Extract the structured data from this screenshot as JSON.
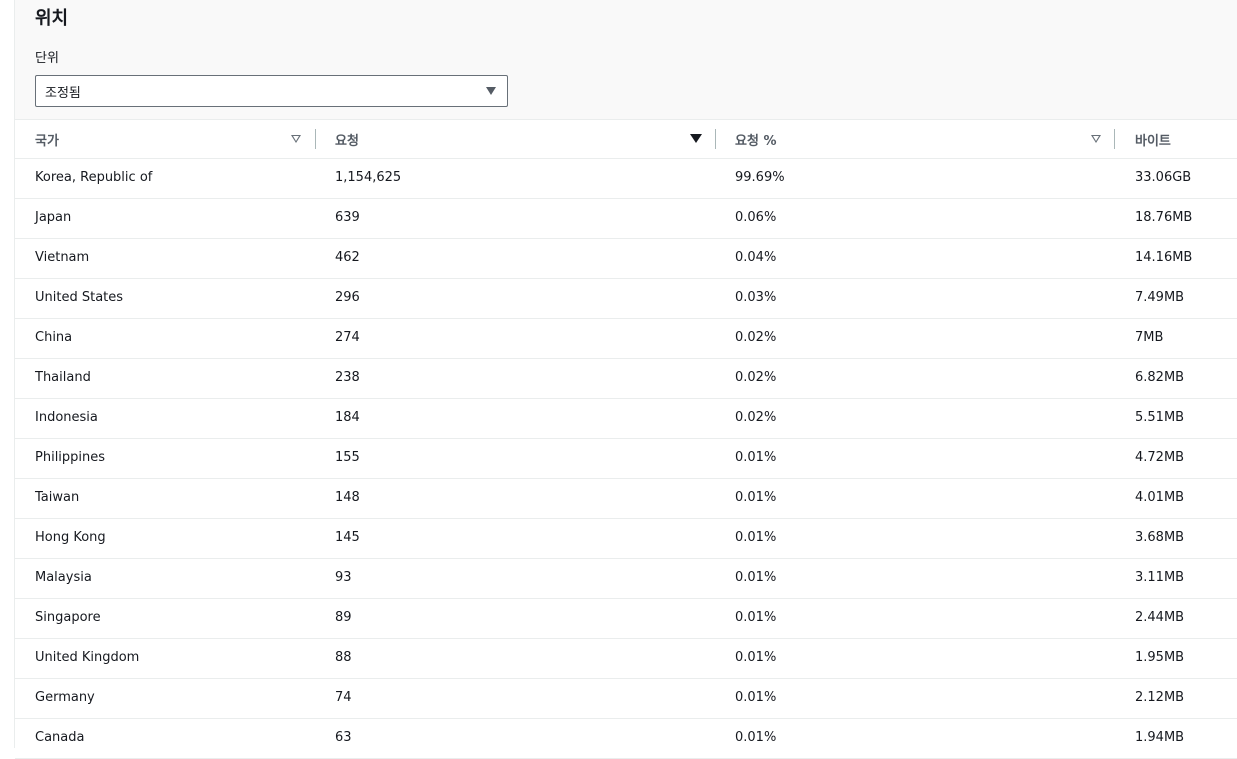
{
  "panel": {
    "title": "위치",
    "unit_label": "단위",
    "unit_select": {
      "value": "조정됨"
    }
  },
  "table": {
    "columns": [
      {
        "label": "국가",
        "sort": "none"
      },
      {
        "label": "요청",
        "sort": "descending"
      },
      {
        "label": "요청 %",
        "sort": "none"
      },
      {
        "label": "바이트",
        "sort": "none"
      }
    ],
    "rows": [
      {
        "country": "Korea, Republic of",
        "requests": "1,154,625",
        "percent": "99.69%",
        "bytes": "33.06GB"
      },
      {
        "country": "Japan",
        "requests": "639",
        "percent": "0.06%",
        "bytes": "18.76MB"
      },
      {
        "country": "Vietnam",
        "requests": "462",
        "percent": "0.04%",
        "bytes": "14.16MB"
      },
      {
        "country": "United States",
        "requests": "296",
        "percent": "0.03%",
        "bytes": "7.49MB"
      },
      {
        "country": "China",
        "requests": "274",
        "percent": "0.02%",
        "bytes": "7MB"
      },
      {
        "country": "Thailand",
        "requests": "238",
        "percent": "0.02%",
        "bytes": "6.82MB"
      },
      {
        "country": "Indonesia",
        "requests": "184",
        "percent": "0.02%",
        "bytes": "5.51MB"
      },
      {
        "country": "Philippines",
        "requests": "155",
        "percent": "0.01%",
        "bytes": "4.72MB"
      },
      {
        "country": "Taiwan",
        "requests": "148",
        "percent": "0.01%",
        "bytes": "4.01MB"
      },
      {
        "country": "Hong Kong",
        "requests": "145",
        "percent": "0.01%",
        "bytes": "3.68MB"
      },
      {
        "country": "Malaysia",
        "requests": "93",
        "percent": "0.01%",
        "bytes": "3.11MB"
      },
      {
        "country": "Singapore",
        "requests": "89",
        "percent": "0.01%",
        "bytes": "2.44MB"
      },
      {
        "country": "United Kingdom",
        "requests": "88",
        "percent": "0.01%",
        "bytes": "1.95MB"
      },
      {
        "country": "Germany",
        "requests": "74",
        "percent": "0.01%",
        "bytes": "2.12MB"
      },
      {
        "country": "Canada",
        "requests": "63",
        "percent": "0.01%",
        "bytes": "1.94MB"
      }
    ]
  }
}
